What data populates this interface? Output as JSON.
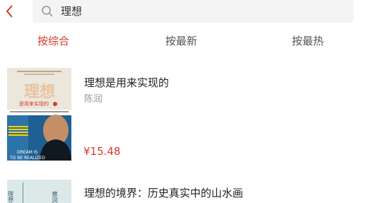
{
  "header": {
    "back_icon": "chevron-left-icon",
    "search_icon": "search-icon",
    "search_value": "理想"
  },
  "tabs": [
    {
      "label": "按综合",
      "active": true
    },
    {
      "label": "按最新",
      "active": false
    },
    {
      "label": "按最热",
      "active": false
    }
  ],
  "books": [
    {
      "title": "理想是用来实现的",
      "author": "陈润",
      "price": "¥15.48",
      "cover": {
        "title": "理想",
        "subtitle": "是用来实现的",
        "english_line1": "DREAM IS",
        "english_line2": "TO BE REALIZED"
      }
    },
    {
      "title": "理想的境界：历史真实中的山水画",
      "cover": {
        "text_left": "理想的",
        "text_right": "意河"
      }
    }
  ],
  "colors": {
    "accent": "#d9372c",
    "search_bg": "#f4f4f4"
  }
}
